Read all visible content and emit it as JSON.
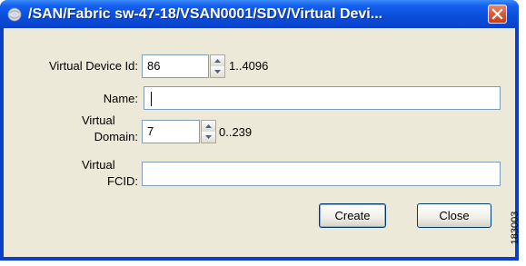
{
  "window": {
    "title": "/SAN/Fabric sw-47-18/VSAN0001/SDV/Virtual Devi..."
  },
  "form": {
    "virtual_device_id": {
      "label": "Virtual Device Id:",
      "value": "86",
      "range": "1..4096"
    },
    "name": {
      "label": "Name:",
      "value": ""
    },
    "virtual_domain": {
      "label_line1": "Virtual",
      "label_line2": "Domain:",
      "value": "7",
      "range": "0..239"
    },
    "virtual_fcid": {
      "label_line1": "Virtual",
      "label_line2": "FCID:",
      "value": ""
    }
  },
  "buttons": {
    "create": "Create",
    "close": "Close"
  },
  "watermark": "183003",
  "colors": {
    "titlebar": "#0a4fd9",
    "dialog_bg": "#ece9d8",
    "close_button": "#d65a36",
    "field_border": "#7f9db9"
  }
}
